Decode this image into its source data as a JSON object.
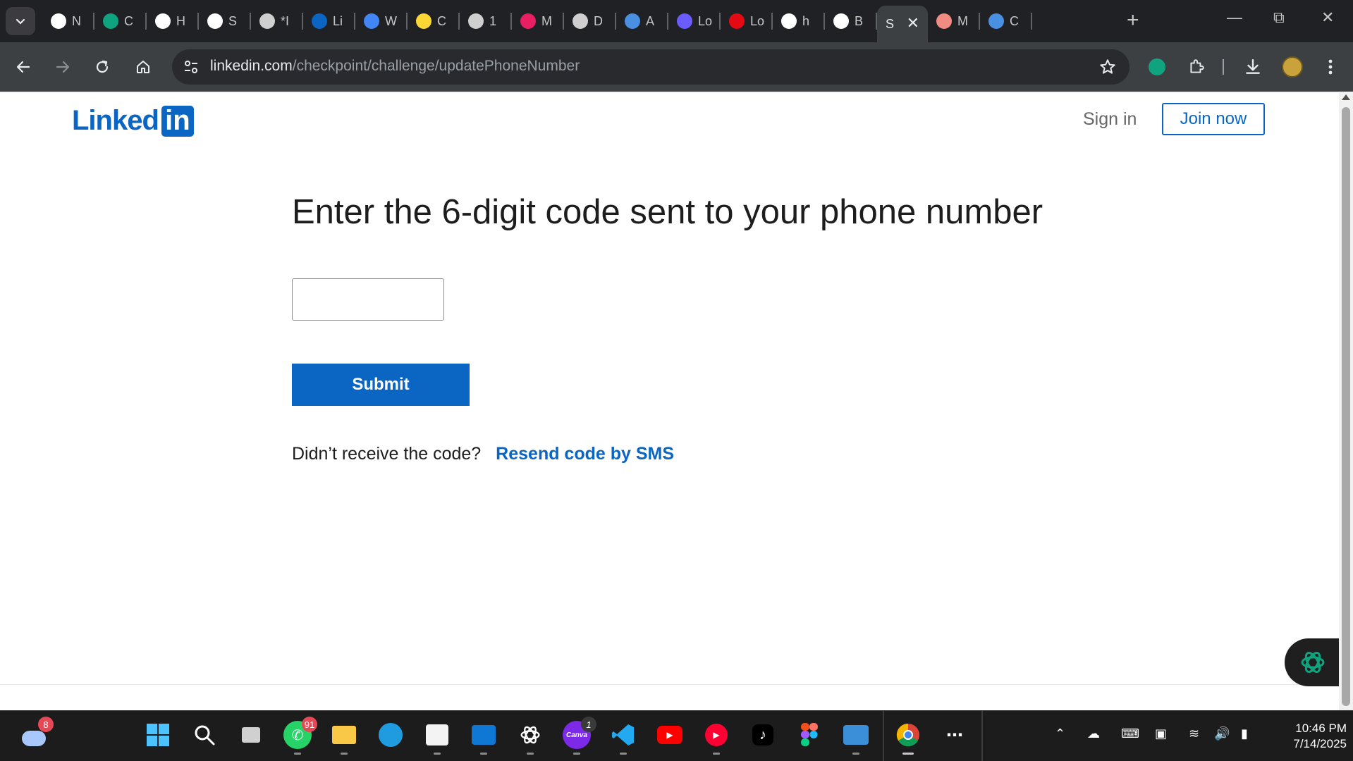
{
  "browser": {
    "tabs": [
      {
        "label": "N",
        "icon": "chrome-icon",
        "color": "#ffffff"
      },
      {
        "label": "C",
        "icon": "chatgpt-icon",
        "color": "#10a37f"
      },
      {
        "label": "H",
        "icon": "history-icon",
        "color": "#ffffff"
      },
      {
        "label": "S",
        "icon": "code-icon",
        "color": "#ffffff"
      },
      {
        "label": "*I",
        "icon": "globe-icon",
        "color": "#cfcfcf"
      },
      {
        "label": "Li",
        "icon": "linkedin-icon",
        "color": "#0a66c2"
      },
      {
        "label": "W",
        "icon": "search-icon",
        "color": "#4285f4"
      },
      {
        "label": "C",
        "icon": "flag-icon",
        "color": "#fdd835"
      },
      {
        "label": "1",
        "icon": "aperture-icon",
        "color": "#cfcfcf"
      },
      {
        "label": "M",
        "icon": "multicolor-icon",
        "color": "#e91e63"
      },
      {
        "label": "D",
        "icon": "globe-icon",
        "color": "#cfcfcf"
      },
      {
        "label": "A",
        "icon": "doc-icon",
        "color": "#4a90e2"
      },
      {
        "label": "Lo",
        "icon": "c-logo-icon",
        "color": "#6a5cff"
      },
      {
        "label": "Lo",
        "icon": "n-logo-icon",
        "color": "#e50914"
      },
      {
        "label": "h",
        "icon": "google-icon",
        "color": "#ffffff"
      },
      {
        "label": "B",
        "icon": "p-logo-icon",
        "color": "#ffffff"
      },
      {
        "label": "S",
        "icon": "active-tab",
        "color": "#3c4043"
      },
      {
        "label": "M",
        "icon": "image-icon",
        "color": "#f28b82"
      },
      {
        "label": "C",
        "icon": "doc-icon",
        "color": "#4a90e2"
      }
    ],
    "url_host": "linkedin.com",
    "url_path": "/checkpoint/challenge/updatePhoneNumber"
  },
  "header": {
    "logo_text": "Linked",
    "logo_in": "in",
    "sign_in": "Sign in",
    "join_now": "Join now"
  },
  "main": {
    "heading": "Enter the 6-digit code sent to your phone number",
    "code_value": "",
    "submit_label": "Submit",
    "resend_prompt": "Didn’t receive the code?",
    "resend_link": "Resend code by SMS"
  },
  "taskbar": {
    "weather_badge": "8",
    "whatsapp_badge": "91",
    "canva_badge": "1",
    "canva_label": "Canva",
    "time": "10:46 PM",
    "date": "7/14/2025"
  },
  "colors": {
    "brand": "#0a66c2",
    "chrome_dark": "#202124",
    "toolbar": "#3c4043"
  }
}
